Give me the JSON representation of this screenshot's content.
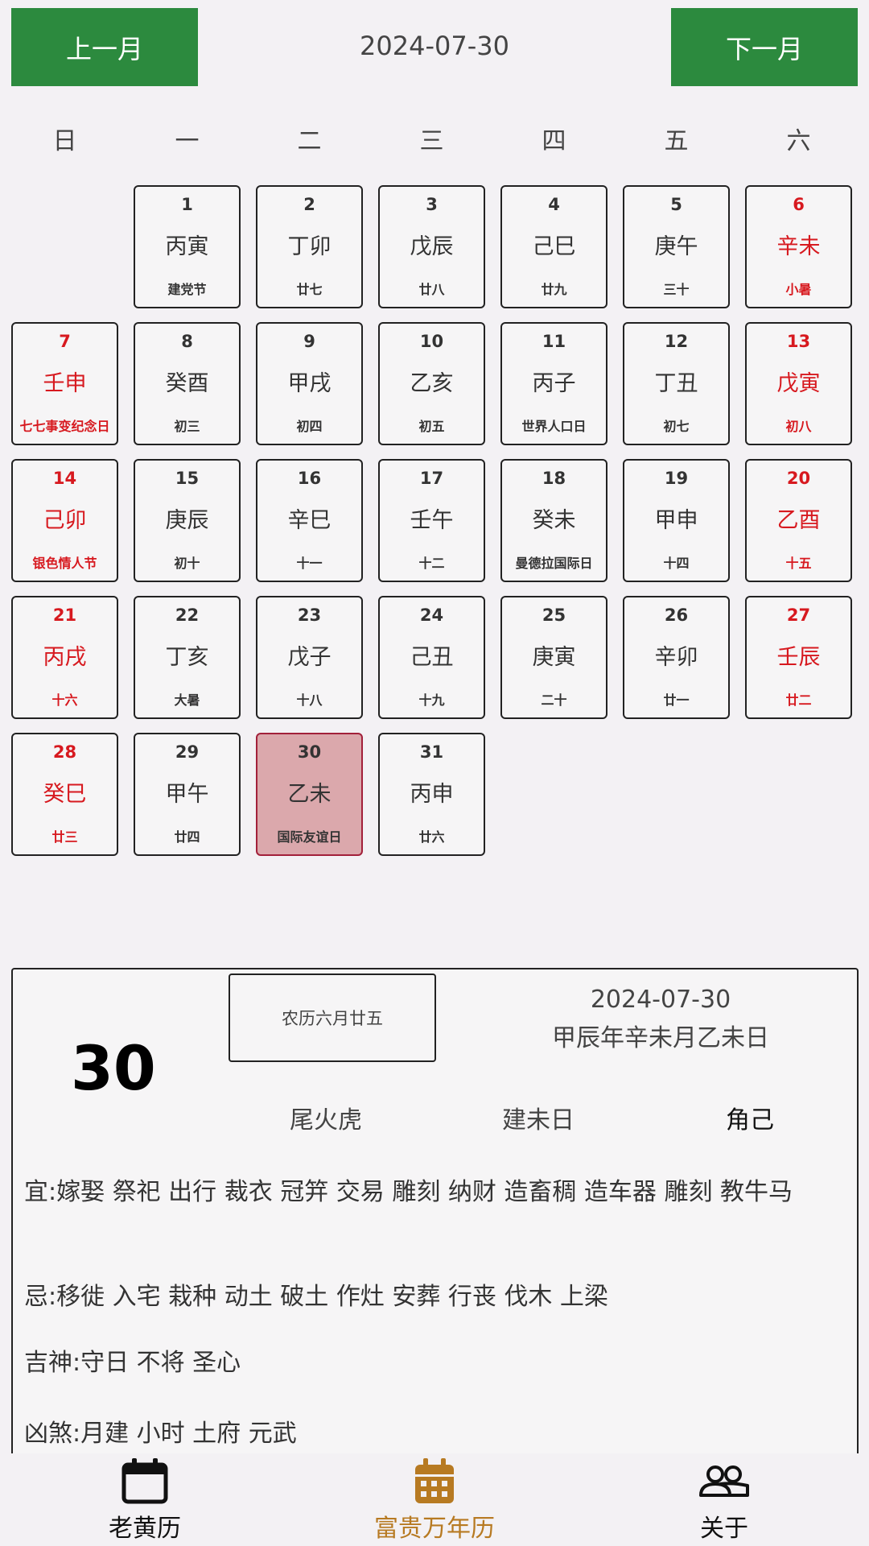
{
  "header": {
    "prev_label": "上一月",
    "next_label": "下一月",
    "current_date": "2024-07-30"
  },
  "weekdays": [
    "日",
    "一",
    "二",
    "三",
    "四",
    "五",
    "六"
  ],
  "calendar": {
    "first_weekday_offset": 1,
    "selected_day": 30,
    "days": [
      {
        "num": "1",
        "gz": "丙寅",
        "sub": "建党节"
      },
      {
        "num": "2",
        "gz": "丁卯",
        "sub": "廿七"
      },
      {
        "num": "3",
        "gz": "戊辰",
        "sub": "廿八"
      },
      {
        "num": "4",
        "gz": "己巳",
        "sub": "廿九"
      },
      {
        "num": "5",
        "gz": "庚午",
        "sub": "三十"
      },
      {
        "num": "6",
        "gz": "辛未",
        "sub": "小暑"
      },
      {
        "num": "7",
        "gz": "壬申",
        "sub": "七七事变纪念日"
      },
      {
        "num": "8",
        "gz": "癸酉",
        "sub": "初三"
      },
      {
        "num": "9",
        "gz": "甲戌",
        "sub": "初四"
      },
      {
        "num": "10",
        "gz": "乙亥",
        "sub": "初五"
      },
      {
        "num": "11",
        "gz": "丙子",
        "sub": "世界人口日"
      },
      {
        "num": "12",
        "gz": "丁丑",
        "sub": "初七"
      },
      {
        "num": "13",
        "gz": "戊寅",
        "sub": "初八"
      },
      {
        "num": "14",
        "gz": "己卯",
        "sub": "银色情人节"
      },
      {
        "num": "15",
        "gz": "庚辰",
        "sub": "初十"
      },
      {
        "num": "16",
        "gz": "辛巳",
        "sub": "十一"
      },
      {
        "num": "17",
        "gz": "壬午",
        "sub": "十二"
      },
      {
        "num": "18",
        "gz": "癸未",
        "sub": "曼德拉国际日"
      },
      {
        "num": "19",
        "gz": "甲申",
        "sub": "十四"
      },
      {
        "num": "20",
        "gz": "乙酉",
        "sub": "十五"
      },
      {
        "num": "21",
        "gz": "丙戌",
        "sub": "十六"
      },
      {
        "num": "22",
        "gz": "丁亥",
        "sub": "大暑"
      },
      {
        "num": "23",
        "gz": "戊子",
        "sub": "十八"
      },
      {
        "num": "24",
        "gz": "己丑",
        "sub": "十九"
      },
      {
        "num": "25",
        "gz": "庚寅",
        "sub": "二十"
      },
      {
        "num": "26",
        "gz": "辛卯",
        "sub": "廿一"
      },
      {
        "num": "27",
        "gz": "壬辰",
        "sub": "廿二"
      },
      {
        "num": "28",
        "gz": "癸巳",
        "sub": "廿三"
      },
      {
        "num": "29",
        "gz": "甲午",
        "sub": "廿四"
      },
      {
        "num": "30",
        "gz": "乙未",
        "sub": "国际友谊日"
      },
      {
        "num": "31",
        "gz": "丙申",
        "sub": "廿六"
      }
    ]
  },
  "detail": {
    "big_day": "30",
    "lunar": "农历六月廿五",
    "date": "2024-07-30",
    "ganzhi": "甲辰年辛未月乙未日",
    "xiu": "尾火虎",
    "jian": "建未日",
    "jiao": "角己",
    "yi": "宜:嫁娶  祭祀 出行 裁衣 冠笄 交易 雕刻 纳财 造畜稠  造车器  雕刻 教牛马",
    "ji": "忌:移徙  入宅 栽种 动土 破土 作灶 安葬 行丧 伐木 上梁",
    "jishen": "吉神:守日   不将  圣心",
    "xiongsha": "凶煞:月建   小时  土府  元武"
  },
  "colors": {
    "accent_green": "#2c8a3e",
    "weekend_red": "#d7191f",
    "selected_bg": "#dba8ac",
    "active_tab": "#b77a22"
  },
  "bottom_nav": {
    "items": [
      {
        "label": "老黄历",
        "icon": "calendar-icon",
        "active": false
      },
      {
        "label": "富贵万年历",
        "icon": "calendar-grid-icon",
        "active": true
      },
      {
        "label": "关于",
        "icon": "people-icon",
        "active": false
      }
    ]
  }
}
